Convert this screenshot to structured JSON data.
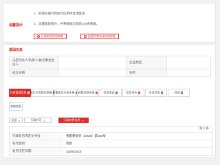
{
  "tips": {
    "label": "温馨提示",
    "lines": [
      "1、如需开展行政处罚信用修复请登录",
      "2、设置截屏部分，并将数据记录后100条数据。"
    ],
    "buttons": [
      "行政处罚信用修复",
      "经营异常名录信用修复"
    ]
  },
  "base": {
    "section_title": "基础信息",
    "rows": [
      {
        "k1": "法定代表人/负责人/执行事务合伙人",
        "v1": "",
        "k2": "企业类型",
        "v2": ""
      },
      {
        "k1": "成立日期",
        "v1": "",
        "k2": "住所",
        "v2": ""
      }
    ]
  },
  "categories": [
    {
      "label": "行政管理信息",
      "count": "4"
    },
    {
      "label": "诚实守信相关荣誉",
      "count": "0"
    },
    {
      "label": "严重失信主体名单",
      "count": "0"
    },
    {
      "label": "经营异常名录",
      "count": "0"
    },
    {
      "label": "信用承诺",
      "count": "0"
    },
    {
      "label": "信用评价",
      "count": "0"
    },
    {
      "label": "司法判决",
      "count": "0"
    },
    {
      "label": "其他",
      "count": "0"
    },
    {
      "label": "其他信息",
      "count": ""
    }
  ],
  "filters": [
    {
      "label": "全部",
      "count": "4"
    },
    {
      "label": "行政许可",
      "count": "2"
    },
    {
      "label": "行政处罚信息",
      "count": "5"
    }
  ],
  "record": {
    "index": "第 1 条",
    "rows": [
      {
        "k": "行政处罚决定文书号:",
        "v": "青医保处罚〔2025〕第033号"
      },
      {
        "k": "处罚类别:",
        "v": "罚款"
      },
      {
        "k": "处罚决定日期:",
        "v": "2025/01/15"
      }
    ]
  }
}
